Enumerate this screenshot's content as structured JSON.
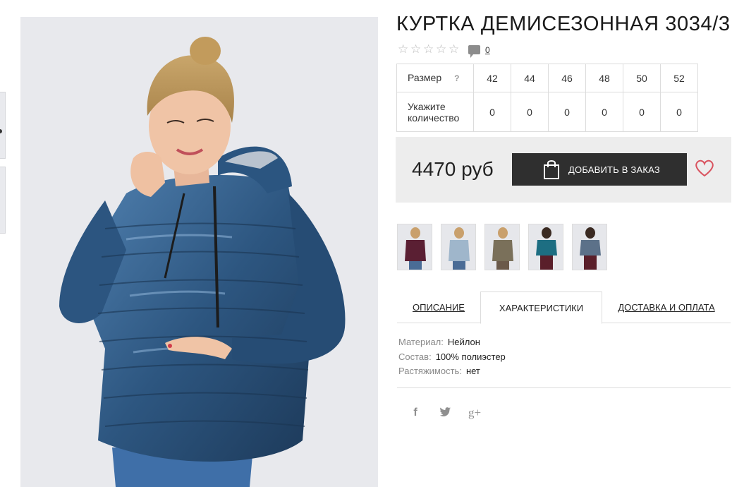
{
  "product": {
    "title": "КУРТКА ДЕМИСЕЗОННАЯ 3034/3",
    "rating": {
      "stars_filled": 0,
      "stars_total": 5,
      "comments": "0"
    },
    "colors": {
      "jacket_main": "#2f5a83",
      "accent": "#d9535f"
    }
  },
  "sizes": {
    "size_label": "Размер",
    "help": "?",
    "quantity_label": "Укажите количество",
    "values": [
      "42",
      "44",
      "46",
      "48",
      "50",
      "52"
    ],
    "quantities": [
      "0",
      "0",
      "0",
      "0",
      "0",
      "0"
    ]
  },
  "purchase": {
    "price": "4470 руб",
    "add_button": "ДОБАВИТЬ В ЗАКАЗ"
  },
  "tabs": {
    "description": "ОПИСАНИЕ",
    "characteristics": "ХАРАКТЕРИСТИКИ",
    "delivery": "ДОСТАВКА И ОПЛАТА"
  },
  "specs": [
    {
      "key": "Материал:",
      "value": "Нейлон"
    },
    {
      "key": "Состав:",
      "value": "100% полиэстер"
    },
    {
      "key": "Растяжимость:",
      "value": "нет"
    }
  ],
  "social": {
    "facebook": "f",
    "twitter": "twitter-icon",
    "googleplus": "g+"
  }
}
